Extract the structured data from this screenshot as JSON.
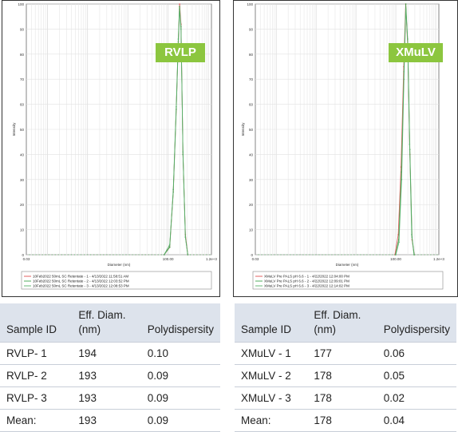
{
  "chart_data": [
    {
      "type": "line",
      "x_scale": "log",
      "xlim": [
        0.03,
        1200
      ],
      "ylim": [
        0,
        100
      ],
      "xlabel": "Diameter (nm)",
      "ylabel": "Intensity",
      "x_tick_labels": [
        "0.03",
        "100.00",
        "1.2e+3"
      ],
      "y_tick_labels": [
        "0",
        "10",
        "20",
        "30",
        "40",
        "50",
        "60",
        "70",
        "80",
        "90",
        "100"
      ],
      "grid": true,
      "legend_position": "bottom",
      "colors": [
        "#e05050",
        "#3fa34d",
        "#56b06a"
      ],
      "series": [
        {
          "name": "10Feb2022 50mL SC Retentate - 1 - 4/13/2022 11:58:51 AM",
          "x": [
            80,
            110,
            135,
            160,
            180,
            194,
            210,
            235,
            270,
            310
          ],
          "y": [
            0,
            3,
            25,
            58,
            85,
            100,
            92,
            40,
            8,
            0
          ]
        },
        {
          "name": "10Feb2022 50mL SC Retentate - 2 - 4/13/2022 12:03:52 PM",
          "x": [
            80,
            110,
            135,
            160,
            180,
            193,
            210,
            235,
            270,
            310
          ],
          "y": [
            0,
            3,
            26,
            59,
            86,
            99,
            91,
            40,
            7,
            0
          ]
        },
        {
          "name": "10Feb2022 50mL SC Retentate - 3 - 4/13/2022 12:08:53 PM",
          "x": [
            80,
            110,
            135,
            160,
            180,
            193,
            210,
            235,
            270,
            310
          ],
          "y": [
            0,
            4,
            25,
            58,
            84,
            98,
            90,
            41,
            7,
            0
          ]
        }
      ]
    },
    {
      "type": "line",
      "x_scale": "log",
      "xlim": [
        0.03,
        1200
      ],
      "ylim": [
        0,
        100
      ],
      "xlabel": "Diameter (nm)",
      "ylabel": "Intensity",
      "x_tick_labels": [
        "0.03",
        "100.00",
        "1.2e+3"
      ],
      "y_tick_labels": [
        "0",
        "10",
        "20",
        "30",
        "40",
        "50",
        "60",
        "70",
        "80",
        "90",
        "100"
      ],
      "grid": true,
      "legend_position": "bottom",
      "colors": [
        "#e05050",
        "#3fa34d",
        "#56b06a"
      ],
      "series": [
        {
          "name": "XMuLV Pre PALS pH 6.6 - 1 - 4/22/2022 12:04:00 PM",
          "x": [
            95,
            115,
            135,
            158,
            177,
            200,
            225,
            255,
            290
          ],
          "y": [
            0,
            8,
            35,
            75,
            100,
            82,
            40,
            6,
            0
          ]
        },
        {
          "name": "XMuLV Pre PALS pH 6.6 - 2 - 4/22/2022 12:09:01 PM",
          "x": [
            98,
            118,
            138,
            160,
            178,
            200,
            225,
            255,
            290
          ],
          "y": [
            0,
            6,
            33,
            73,
            100,
            84,
            42,
            7,
            0
          ]
        },
        {
          "name": "XMuLV Pre PALS pH 6.6 - 3 - 4/22/2022 12:14:02 PM",
          "x": [
            100,
            120,
            140,
            160,
            178,
            198,
            222,
            250,
            285
          ],
          "y": [
            0,
            5,
            30,
            70,
            98,
            86,
            44,
            8,
            0
          ]
        }
      ]
    }
  ],
  "badges": {
    "left": "RVLP",
    "right": "XMuLV"
  },
  "tables": {
    "left": {
      "headers": [
        "Sample ID",
        "Eff. Diam. (nm)",
        "Polydispersity"
      ],
      "rows": [
        [
          "RVLP- 1",
          "194",
          "0.10"
        ],
        [
          "RVLP- 2",
          "193",
          "0.09"
        ],
        [
          "RVLP- 3",
          "193",
          "0.09"
        ],
        [
          "Mean:",
          "193",
          "0.09"
        ]
      ]
    },
    "right": {
      "headers": [
        "Sample ID",
        "Eff. Diam. (nm)",
        "Polydispersity"
      ],
      "rows": [
        [
          "XMuLV - 1",
          "177",
          "0.06"
        ],
        [
          "XMuLV - 2",
          "178",
          "0.05"
        ],
        [
          "XMuLV - 3",
          "178",
          "0.02"
        ],
        [
          "Mean:",
          "178",
          "0.04"
        ]
      ]
    }
  }
}
